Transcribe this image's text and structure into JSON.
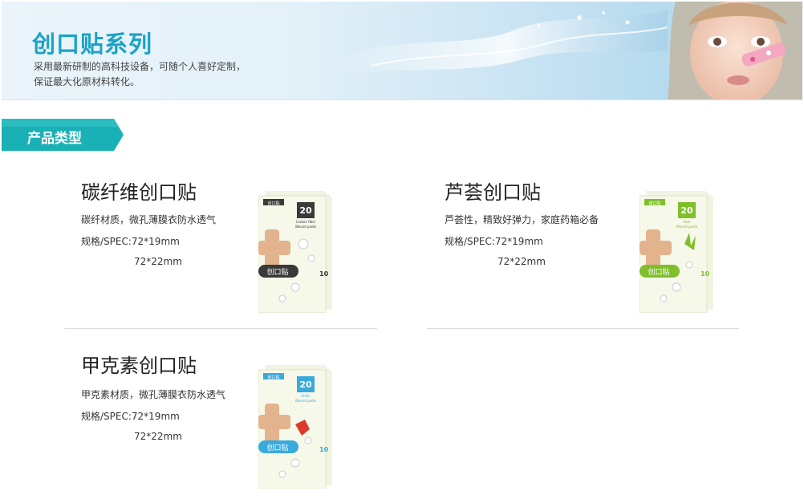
{
  "banner": {
    "title": "创口贴系列",
    "line1": "采用最新研制的高科技设备，可随个人喜好定制，",
    "line2": "保证最大化原材料转化。"
  },
  "section": {
    "label": "产品类型",
    "accent_color": "#1ab1b6"
  },
  "products": [
    {
      "title": "碳纤维创口贴",
      "desc": "碳纤材质，微孔薄膜衣防水透气",
      "spec": "规格/SPEC:72*19mm",
      "spec2": "72*22mm",
      "box": {
        "count": "20",
        "type_cn": "弹力型",
        "type_en": "Carbon fiber",
        "sub_en": "Wound paste",
        "brand": "创口贴",
        "side": "10",
        "color": "#3a3a3a"
      }
    },
    {
      "title": "芦荟创口贴",
      "desc": "芦荟性，精致好弹力，家庭药箱必备",
      "spec": "规格/SPEC:72*19mm",
      "spec2": "72*22mm",
      "box": {
        "count": "20",
        "type_cn": "弹力型",
        "type_en": "Aloe",
        "sub_en": "Wound paste",
        "brand": "创口贴",
        "side": "10",
        "color": "#7fbf2a"
      }
    },
    {
      "title": "甲克素创口贴",
      "desc": "甲克素材质，微孔薄膜衣防水透气",
      "spec": "规格/SPEC:72*19mm",
      "spec2": "72*22mm",
      "box": {
        "count": "20",
        "type_cn": "弹力型",
        "type_en": "Chitin",
        "sub_en": "Wound paste",
        "brand": "创口贴",
        "side": "10",
        "color": "#3aa9dc"
      }
    }
  ]
}
